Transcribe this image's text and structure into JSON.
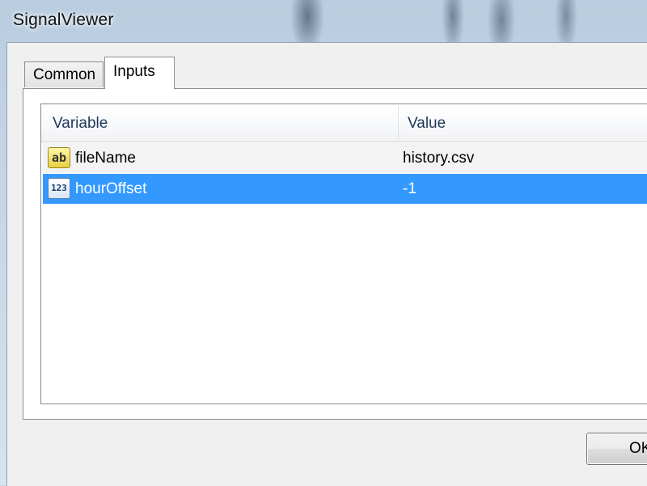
{
  "window": {
    "title": "SignalViewer"
  },
  "tabs": [
    {
      "label": "Common",
      "active": false
    },
    {
      "label": "Inputs",
      "active": true
    }
  ],
  "inputs_table": {
    "columns": [
      "Variable",
      "Value"
    ],
    "rows": [
      {
        "icon": "string-icon",
        "icon_text": "ab",
        "variable": "fileName",
        "value": "history.csv",
        "selected": false
      },
      {
        "icon": "integer-icon",
        "icon_text": "123",
        "variable": "hourOffset",
        "value": "-1",
        "selected": true
      }
    ]
  },
  "buttons": {
    "ok_label": "OK"
  },
  "colors": {
    "selection": "#3399ff",
    "header_text": "#1e395b"
  }
}
